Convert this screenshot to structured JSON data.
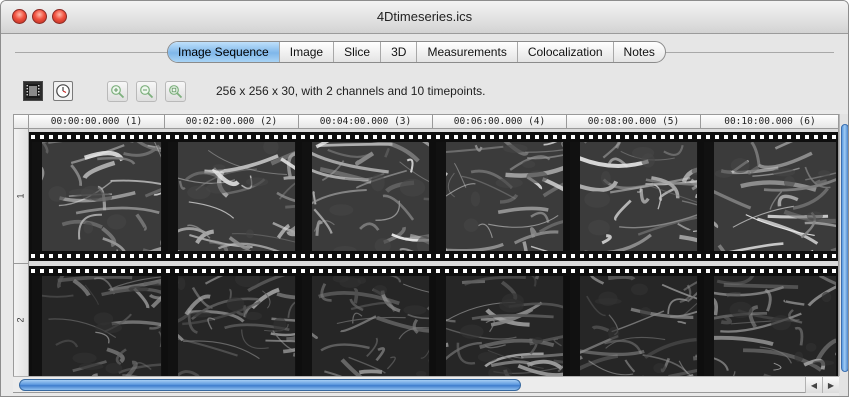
{
  "window": {
    "title": "4Dtimeseries.ics"
  },
  "tabs": [
    {
      "label": "Image Sequence",
      "active": true
    },
    {
      "label": "Image",
      "active": false
    },
    {
      "label": "Slice",
      "active": false
    },
    {
      "label": "3D",
      "active": false
    },
    {
      "label": "Measurements",
      "active": false
    },
    {
      "label": "Colocalization",
      "active": false
    },
    {
      "label": "Notes",
      "active": false
    }
  ],
  "toolbar": {
    "filmstrip_icon": "filmstrip-icon",
    "clock_icon": "clock-icon",
    "zoom_in_icon": "zoom-in-icon",
    "zoom_out_icon": "zoom-out-icon",
    "zoom_fit_icon": "zoom-fit-icon",
    "info": "256 x 256 x 30, with 2 channels and 10 timepoints."
  },
  "timepoints": [
    "00:00:00.000 (1)",
    "00:02:00.000 (2)",
    "00:04:00.000 (3)",
    "00:06:00.000 (4)",
    "00:08:00.000 (5)",
    "00:10:00.000 (6)"
  ],
  "channels": [
    "1",
    "2"
  ],
  "colors": {
    "accent": "#7fb7ea",
    "film": "#0e0e0e",
    "scroll": "#5f9be0"
  }
}
